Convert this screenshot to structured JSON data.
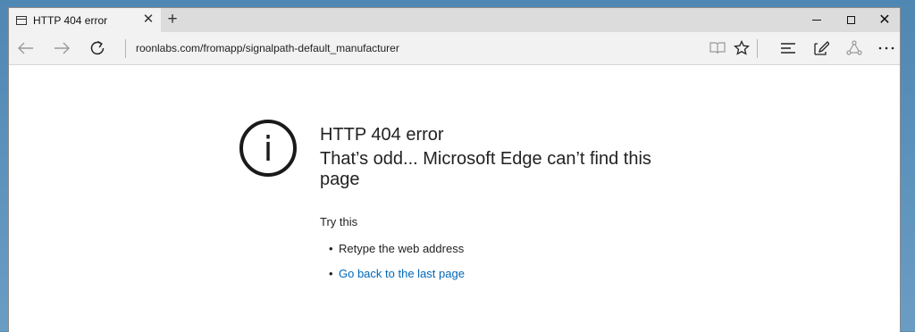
{
  "browser": {
    "tab": {
      "title": "HTTP 404 error",
      "close": "✕"
    },
    "new_tab": "+",
    "window_controls": {
      "close": "✕"
    },
    "address": "roonlabs.com/fromapp/signalpath-default_manufacturer",
    "icons": {
      "back": "back-arrow-icon",
      "forward": "forward-arrow-icon",
      "refresh": "refresh-icon",
      "reading_view": "reading-view-icon",
      "favorite": "star-icon",
      "hub": "hub-icon",
      "web_note": "web-note-icon",
      "share": "share-icon",
      "more": "more-icon"
    }
  },
  "error_page": {
    "icon": "info-icon",
    "title": "HTTP 404 error",
    "subtitle": "That’s odd... Microsoft Edge can’t find this page",
    "try_this": "Try this",
    "tips": [
      {
        "text": "Retype the web address",
        "link": false
      },
      {
        "text": "Go back to the last page",
        "link": true
      }
    ]
  },
  "colors": {
    "link": "#0067b8",
    "text": "#222222",
    "chrome": "#f2f2f2"
  }
}
